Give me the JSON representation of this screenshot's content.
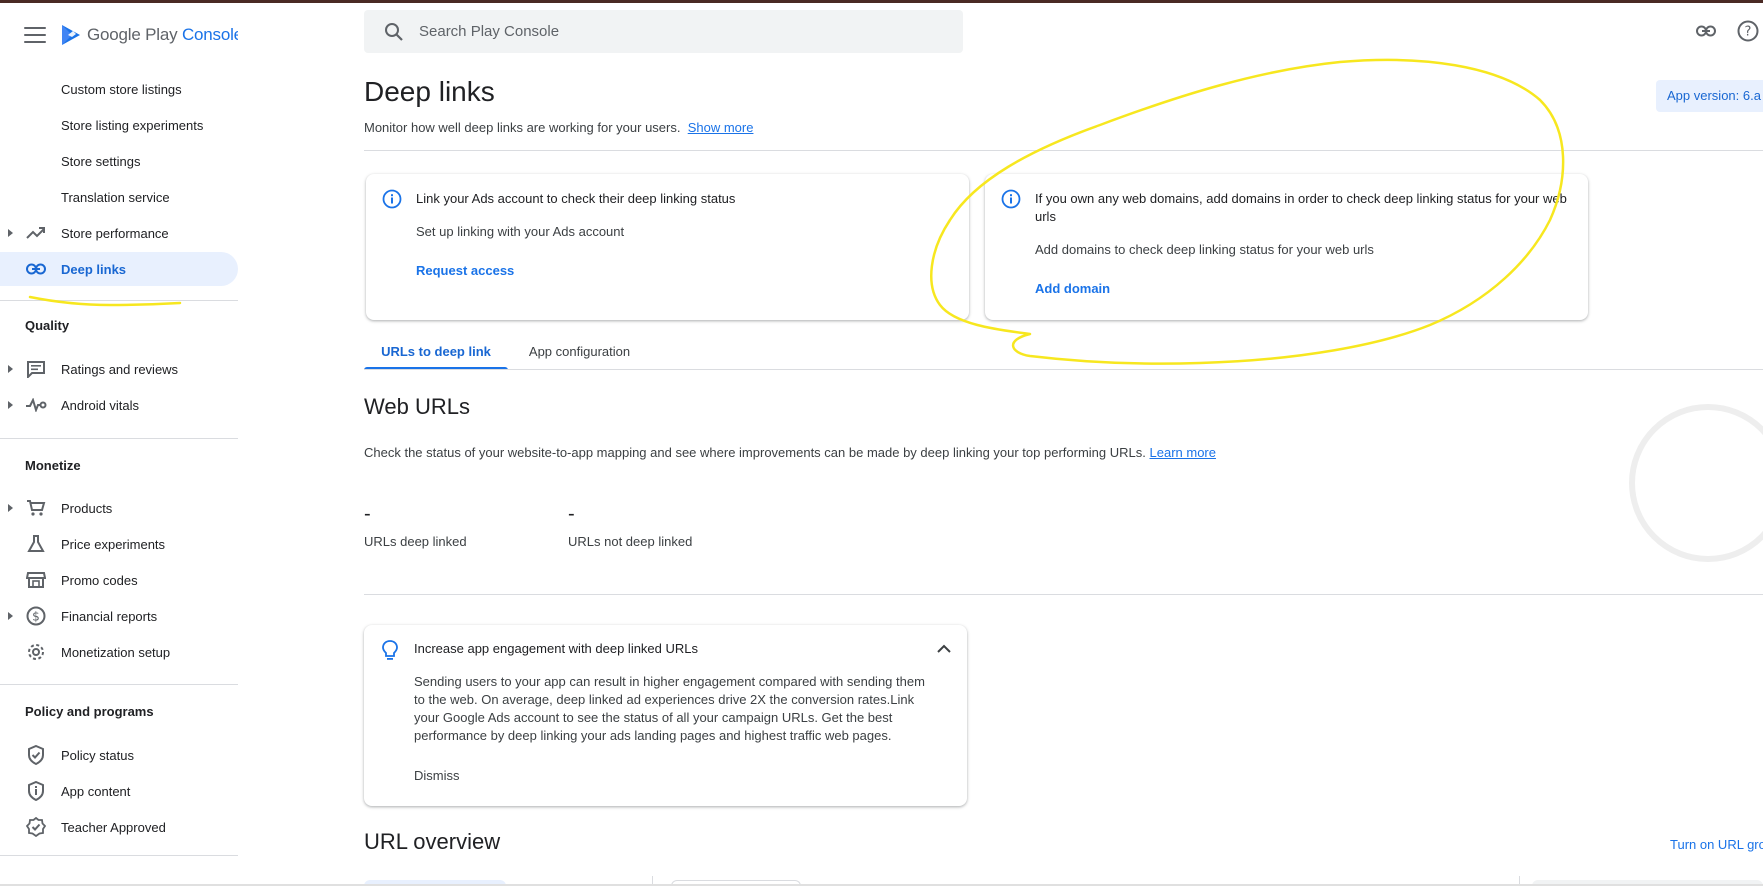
{
  "brand": {
    "name_part1": "Google Play",
    "name_part2": "Console"
  },
  "search": {
    "placeholder": "Search Play Console"
  },
  "sidebar": {
    "store_items": [
      {
        "label": "Custom store listings"
      },
      {
        "label": "Store listing experiments"
      },
      {
        "label": "Store settings"
      },
      {
        "label": "Translation service"
      }
    ],
    "store_performance": {
      "label": "Store performance"
    },
    "deep_links": {
      "label": "Deep links"
    },
    "quality": {
      "title": "Quality",
      "items": [
        {
          "label": "Ratings and reviews"
        },
        {
          "label": "Android vitals"
        }
      ]
    },
    "monetize": {
      "title": "Monetize",
      "items": [
        {
          "label": "Products"
        },
        {
          "label": "Price experiments"
        },
        {
          "label": "Promo codes"
        },
        {
          "label": "Financial reports"
        },
        {
          "label": "Monetization setup"
        }
      ]
    },
    "policy": {
      "title": "Policy and programs",
      "items": [
        {
          "label": "Policy status"
        },
        {
          "label": "App content"
        },
        {
          "label": "Teacher Approved"
        }
      ]
    }
  },
  "header": {
    "title": "Deep links",
    "subtitle": "Monitor how well deep links are working for your users.",
    "show_more": "Show more",
    "app_version": "App version: 6.a"
  },
  "cards": {
    "ads": {
      "title": "Link your Ads account to check their deep linking status",
      "body": "Set up linking with your Ads account",
      "action": "Request access"
    },
    "domains": {
      "title": "If you own any web domains, add domains in order to check deep linking status for your web urls",
      "body": "Add domains to check deep linking status for your web urls",
      "action": "Add domain"
    }
  },
  "tabs": [
    {
      "label": "URLs to deep link"
    },
    {
      "label": "App configuration"
    }
  ],
  "web_urls": {
    "title": "Web URLs",
    "description": "Check the status of your website-to-app mapping and see where improvements can be made by deep linking your top performing URLs.",
    "learn_more": "Learn more",
    "metrics": [
      {
        "value": "-",
        "label": "URLs deep linked"
      },
      {
        "value": "-",
        "label": "URLs not deep linked"
      }
    ]
  },
  "tip": {
    "title": "Increase app engagement with deep linked URLs",
    "body": "Sending users to your app can result in higher engagement compared with sending them to the web. On average, deep linked ad experiences drive 2X the conversion rates.Link your Google Ads account to see the status of all your campaign URLs. Get the best performance by deep linking your ads landing pages and highest traffic web pages.",
    "dismiss": "Dismiss"
  },
  "url_overview": {
    "title": "URL overview",
    "action": "Turn on URL gro"
  },
  "colors": {
    "accent": "#1a73e8",
    "active_bg": "#e8f0fe",
    "annotation": "#f7e71f"
  }
}
